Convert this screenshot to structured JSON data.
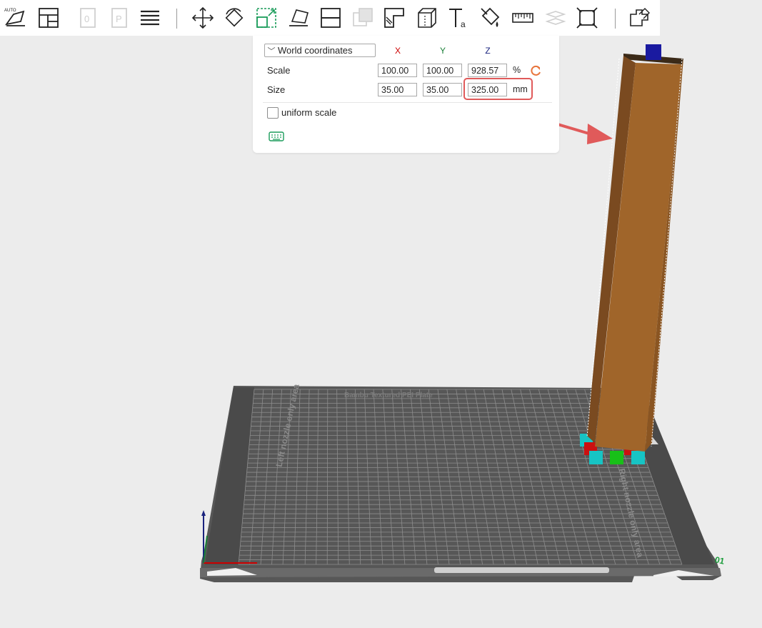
{
  "toolbar": {
    "icons": [
      "auto-orient-icon",
      "arrange-icon",
      "add-plate-icon",
      "add-plate-p-icon",
      "layers-icon",
      "move-icon",
      "rotate-icon",
      "scale-icon",
      "lay-on-face-icon",
      "cut-icon",
      "boolean-icon",
      "support-painting-icon",
      "seam-painting-icon",
      "text-icon",
      "color-painting-icon",
      "measure-icon",
      "assembly-icon",
      "fit-bed-icon",
      "split-parts-icon"
    ],
    "auto_label": "AUTO"
  },
  "panel": {
    "coordinate_system": "World coordinates",
    "axes": {
      "x": "X",
      "y": "Y",
      "z": "Z"
    },
    "scale": {
      "label": "Scale",
      "x": "100.00",
      "y": "100.00",
      "z": "928.57",
      "unit": "%"
    },
    "size": {
      "label": "Size",
      "x": "35.00",
      "y": "35.00",
      "z": "325.00",
      "unit": "mm"
    },
    "uniform_scale": {
      "label": "uniform scale",
      "checked": false
    }
  },
  "bed": {
    "left_label": "Left nozzle only area",
    "right_label": "Right nozzle only area",
    "top_label": "Bambu Textured PEI Plate",
    "plate_number": "01"
  },
  "colors": {
    "accent_red": "#e05a5a",
    "axis_x": "#cc0000",
    "axis_y": "#1a7f37",
    "axis_z": "#1a237e",
    "tower": "#a0652a",
    "bed": "#5a5a5a"
  }
}
